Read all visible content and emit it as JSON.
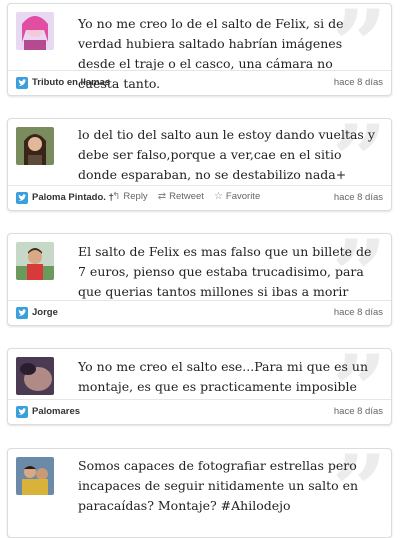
{
  "tweets": [
    {
      "text": "Yo no me creo lo de el salto de Felix, si de verdad hubiera saltado habrían imágenes desde el traje o el casco, una cámara no cuesta tanto.",
      "author": "Tributo en llamas",
      "time": "hace 8 días"
    },
    {
      "text": "lo del tio del salto aun le estoy dando vueltas y debe ser falso,porque a ver,cae en el sitio donde esparaban, no se destabilizo nada+",
      "author": "Paloma Pintado.",
      "author_suffix": "†",
      "time": "hace 8 días",
      "actions": {
        "reply": "Reply",
        "retweet": "Retweet",
        "favorite": "Favorite"
      }
    },
    {
      "text": "El salto de Felix es mas falso que un billete de 7 euros, pienso que estaba trucadisimo, para que querias tantos millones si ibas a morir",
      "author": "Jorge",
      "time": "hace 8 días"
    },
    {
      "text": "Yo no me creo el salto ese...Para mi que es un montaje, es que es practicamente imposible",
      "author": "Palomares",
      "time": "hace 8 días"
    },
    {
      "text": "Somos capaces de fotografiar estrellas pero incapaces de seguir nitidamente un salto en paracaídas? Montaje? #Ahilodejo",
      "author": "",
      "time": ""
    }
  ],
  "icons": {
    "source": "twitter-bird-icon",
    "quote": "quote-mark-icon"
  },
  "colors": {
    "twitter": "#3a9fdc",
    "quote": "#ececec",
    "border": "#dcdcdc"
  }
}
